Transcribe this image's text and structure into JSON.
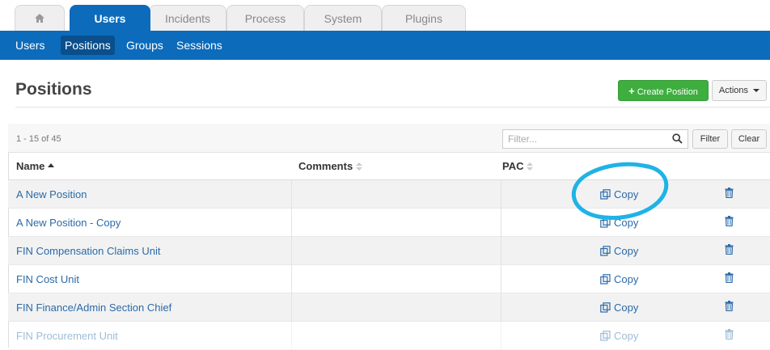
{
  "tabs": [
    {
      "label": "",
      "icon": "home-icon"
    },
    {
      "label": "Users",
      "active": true
    },
    {
      "label": "Incidents"
    },
    {
      "label": "Process"
    },
    {
      "label": "System"
    },
    {
      "label": "Plugins"
    }
  ],
  "subnav": [
    "Users",
    "Positions",
    "Groups",
    "Sessions"
  ],
  "subnav_active": "Positions",
  "header": {
    "title": "Positions",
    "create_button": "Create Position",
    "actions_button": "Actions"
  },
  "toolbar": {
    "count": "1 - 15 of 45",
    "filter_placeholder": "Filter...",
    "filter_button": "Filter",
    "clear_button": "Clear"
  },
  "columns": {
    "name": "Name",
    "comments": "Comments",
    "pac": "PAC"
  },
  "rows": [
    {
      "name": "A New Position",
      "copy": "Copy"
    },
    {
      "name": "A New Position - Copy",
      "copy": "Copy"
    },
    {
      "name": "FIN Compensation Claims Unit",
      "copy": "Copy"
    },
    {
      "name": "FIN Cost Unit",
      "copy": "Copy"
    },
    {
      "name": "FIN Finance/Admin Section Chief",
      "copy": "Copy"
    },
    {
      "name": "FIN Procurement Unit",
      "copy": "Copy"
    }
  ],
  "colors": {
    "brand_blue": "#0c6bbb",
    "create_green": "#3eae3e",
    "link_blue": "#2a6aa8",
    "annotation_cyan": "#1fb3e6"
  }
}
